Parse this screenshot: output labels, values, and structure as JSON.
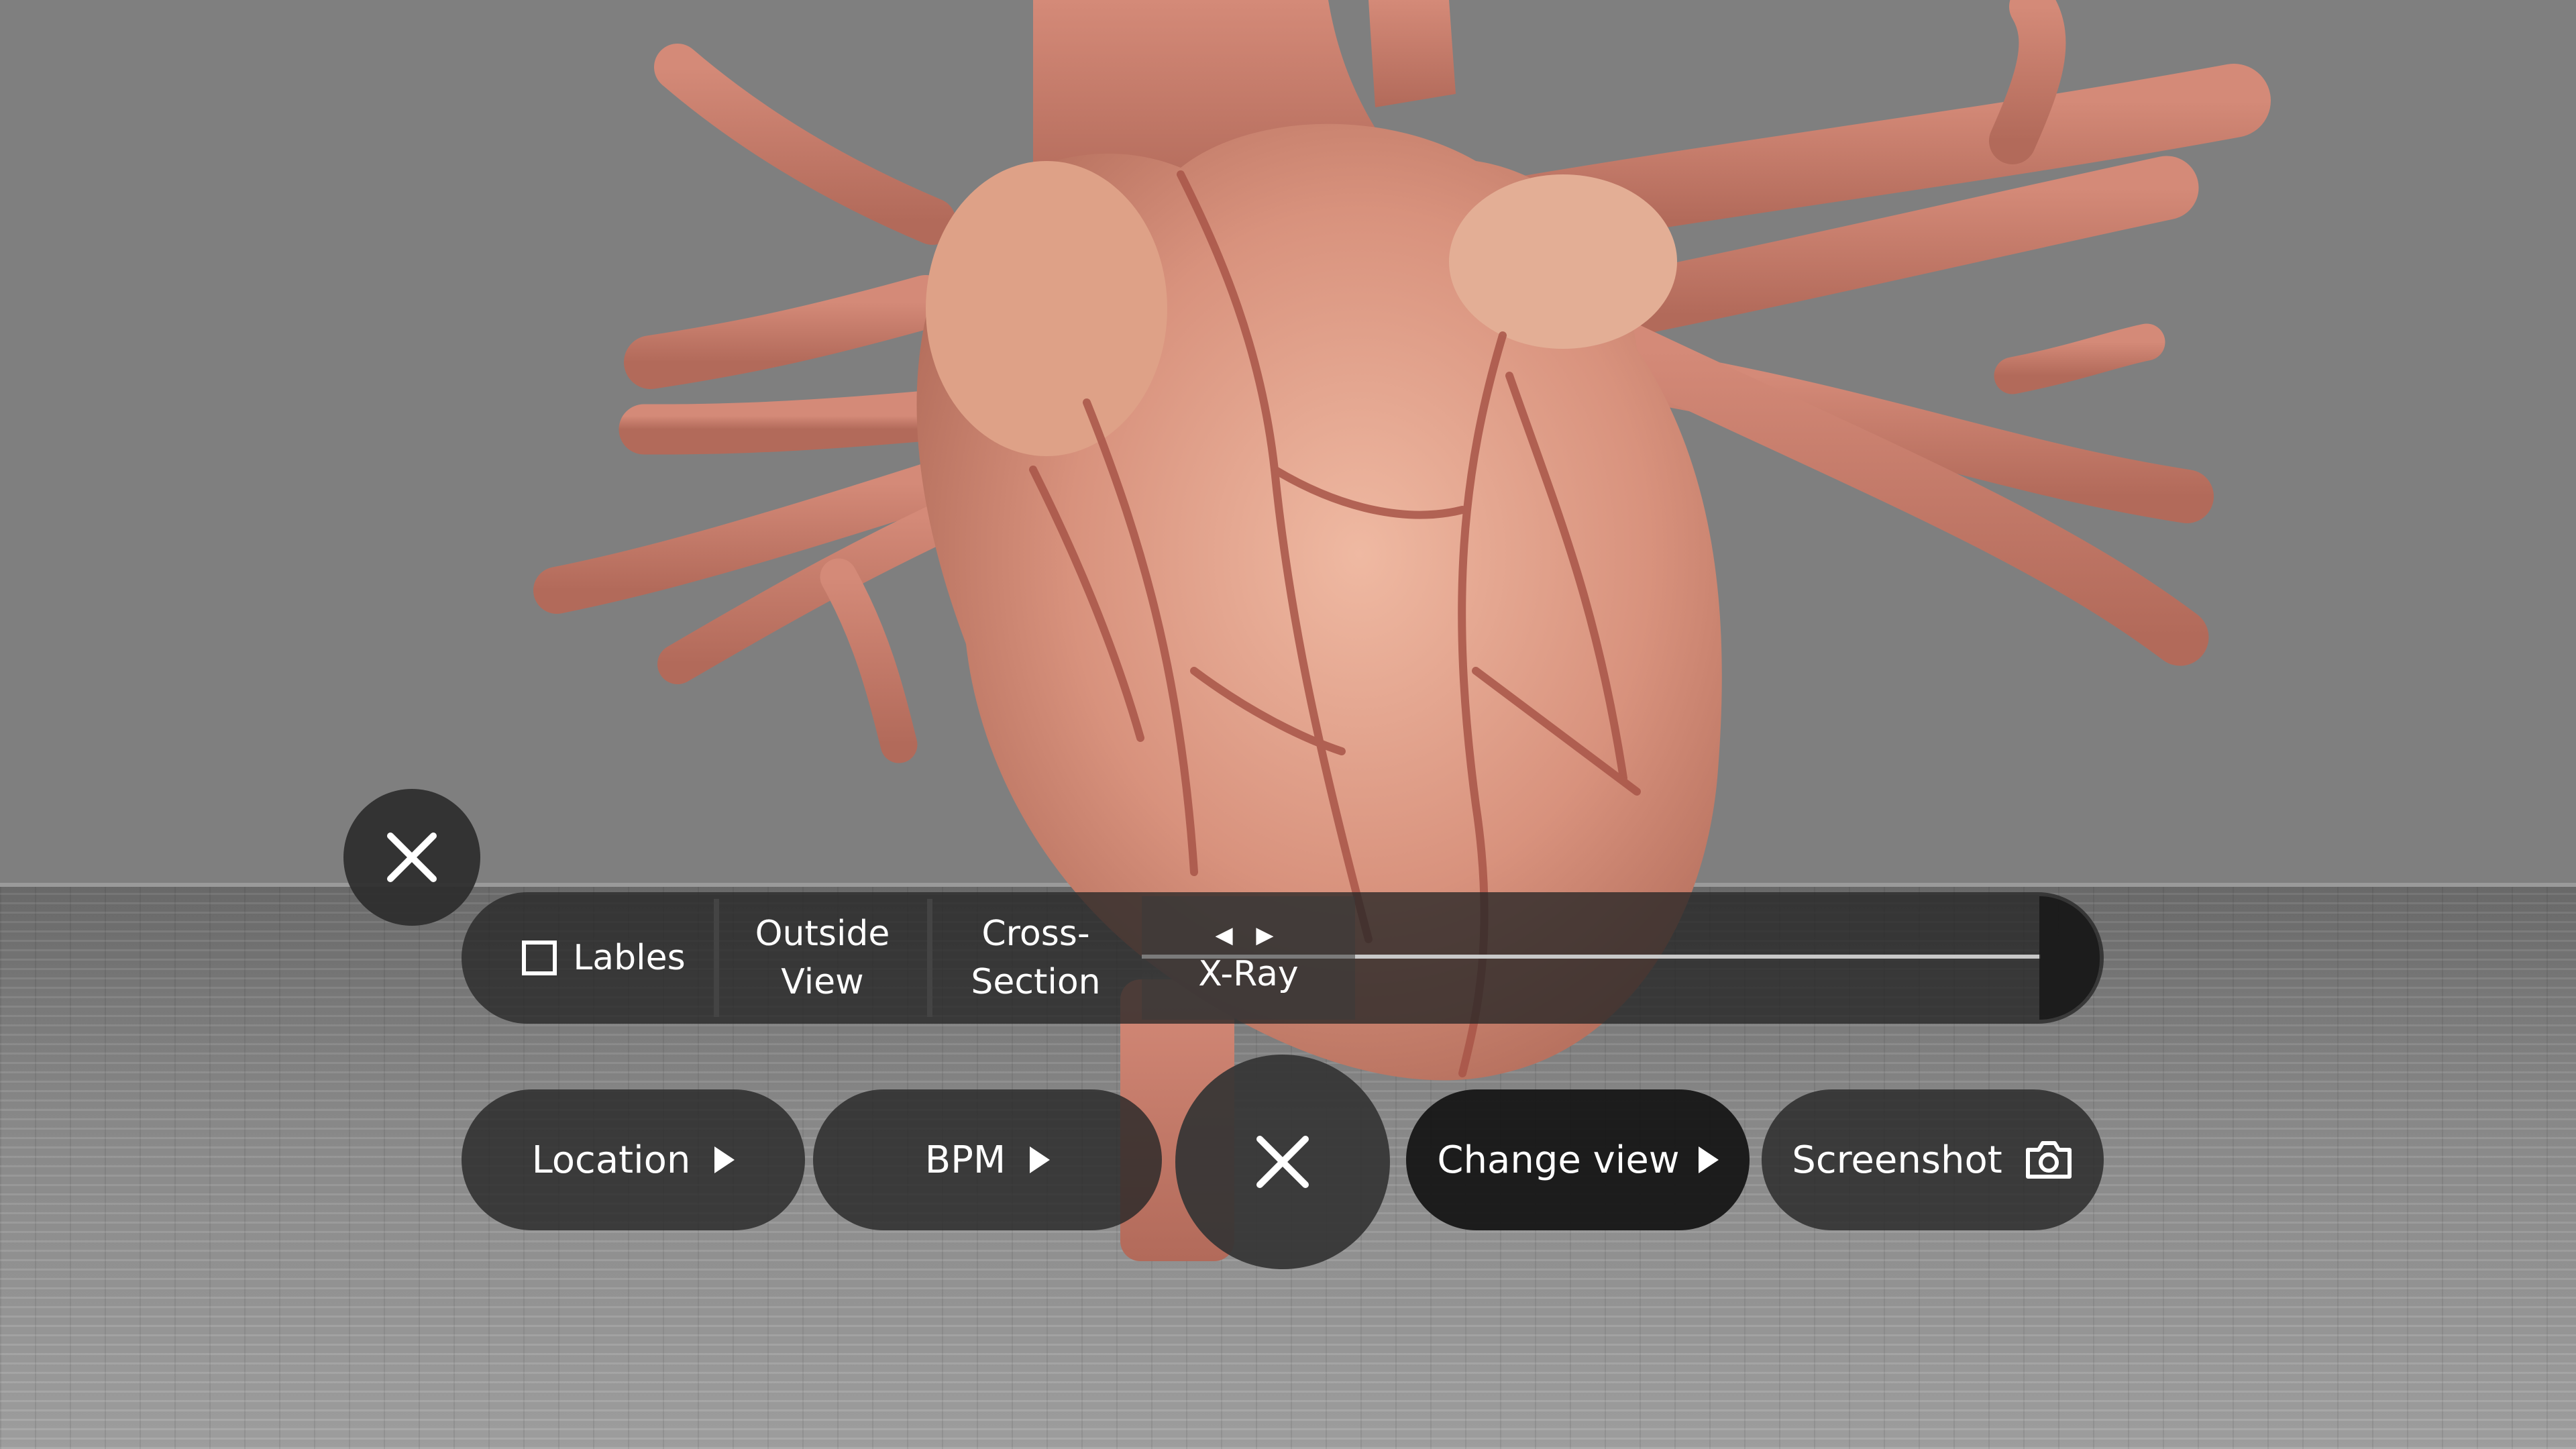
{
  "toolbar": {
    "labels_toggle": "Lables",
    "outside_view_line1": "Outside",
    "outside_view_line2": "View",
    "cross_section_line1": "Cross-",
    "cross_section_line2": "Section",
    "xray_label": "X-Ray",
    "xray_arrows": "◀ ▶"
  },
  "actions": {
    "location": "Location",
    "bpm": "BPM",
    "change_view": "Change view",
    "screenshot": "Screenshot"
  },
  "icons": {
    "close_top": "close-icon",
    "close_center": "close-icon",
    "camera": "camera-icon",
    "play": "play-icon"
  },
  "colors": {
    "background": "#7f7f7f",
    "panel": "#262626",
    "heart_tissue": "#d8927d",
    "vessel": "#c6786a"
  }
}
